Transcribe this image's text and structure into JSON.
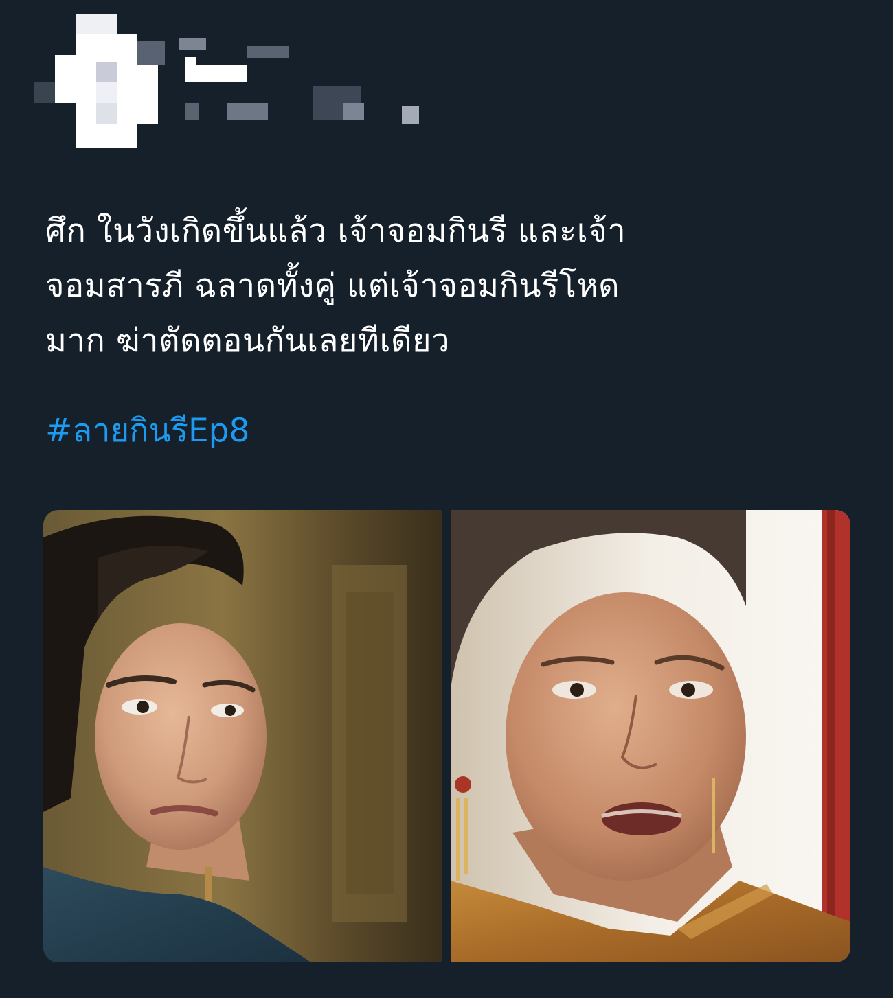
{
  "user": {
    "avatar_icon": "censored-avatar-icon",
    "display_name_icon": "censored-name-icon"
  },
  "tweet": {
    "text_lines": [
      "ศึก ในวังเกิดขึ้นแล้ว เจ้าจอมกินรี และเจ้า",
      "จอมสารภี ฉลาดทั้งคู่ แต่เจ้าจอมกินรีโหด",
      "มาก ฆ่าตัดตอนกันเลยทีเดียว"
    ],
    "hashtag": "#ลายกินรีEp8"
  },
  "media": {
    "photos": [
      {
        "icon": "young-woman-portrait-icon"
      },
      {
        "icon": "older-woman-portrait-icon"
      }
    ]
  },
  "colors": {
    "background": "#15202b",
    "text": "#ffffff",
    "link": "#1d9bf0"
  }
}
